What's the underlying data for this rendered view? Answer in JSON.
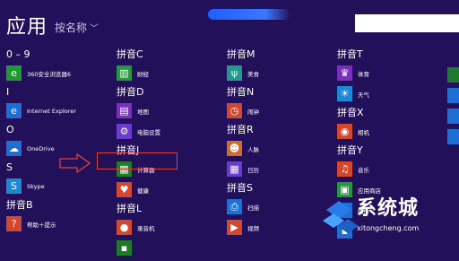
{
  "header": {
    "title": "应用",
    "sort_label": "按名称",
    "search_placeholder": ""
  },
  "columns": [
    {
      "sections": [
        {
          "header": "0 – 9",
          "items": [
            {
              "label": "360安全浏览器6",
              "icon": "360-browser-icon",
              "color": "#1f9a2c"
            }
          ]
        },
        {
          "header": "I",
          "items": [
            {
              "label": "Internet Explorer",
              "icon": "internet-explorer-icon",
              "color": "#1d6fd6"
            }
          ]
        },
        {
          "header": "O",
          "items": [
            {
              "label": "OneDrive",
              "icon": "onedrive-icon",
              "color": "#1d6fd6"
            }
          ]
        },
        {
          "header": "S",
          "items": [
            {
              "label": "Skype",
              "icon": "skype-icon",
              "color": "#1d89d6"
            }
          ]
        },
        {
          "header": "拼音B",
          "items": [
            {
              "label": "帮助＋提示",
              "icon": "help-tips-icon",
              "color": "#d2472d"
            }
          ]
        }
      ]
    },
    {
      "sections": [
        {
          "header": "拼音C",
          "items": [
            {
              "label": "财经",
              "icon": "finance-icon",
              "color": "#1f9a3c"
            }
          ]
        },
        {
          "header": "拼音D",
          "items": [
            {
              "label": "地图",
              "icon": "maps-icon",
              "color": "#7a2fc0"
            },
            {
              "label": "电脑设置",
              "icon": "pc-settings-icon",
              "color": "#6a3bd0"
            }
          ]
        },
        {
          "header": "拼音J",
          "items": [
            {
              "label": "计算器",
              "icon": "calculator-icon",
              "color": "#1f7a2c"
            },
            {
              "label": "健康",
              "icon": "health-icon",
              "color": "#d2472d"
            }
          ]
        },
        {
          "header": "拼音L",
          "items": [
            {
              "label": "录音机",
              "icon": "sound-recorder-icon",
              "color": "#d2472d"
            },
            {
              "label": "",
              "icon": "app-icon",
              "color": "#1f7a2c"
            }
          ]
        }
      ]
    },
    {
      "sections": [
        {
          "header": "拼音M",
          "items": [
            {
              "label": "美食",
              "icon": "food-icon",
              "color": "#1f9a8c"
            }
          ]
        },
        {
          "header": "拼音N",
          "items": [
            {
              "label": "闹钟",
              "icon": "alarms-icon",
              "color": "#d2472d"
            }
          ]
        },
        {
          "header": "拼音R",
          "items": [
            {
              "label": "人脉",
              "icon": "people-icon",
              "color": "#d26a2d"
            },
            {
              "label": "日历",
              "icon": "calendar-icon",
              "color": "#6a3bd0"
            }
          ]
        },
        {
          "header": "拼音S",
          "items": [
            {
              "label": "扫描",
              "icon": "scan-icon",
              "color": "#1d6fd6"
            },
            {
              "label": "视频",
              "icon": "video-icon",
              "color": "#d2472d"
            }
          ]
        }
      ]
    },
    {
      "sections": [
        {
          "header": "拼音T",
          "items": [
            {
              "label": "体育",
              "icon": "sports-icon",
              "color": "#7a2fc0"
            },
            {
              "label": "天气",
              "icon": "weather-icon",
              "color": "#1d89d6"
            }
          ]
        },
        {
          "header": "拼音X",
          "items": [
            {
              "label": "相机",
              "icon": "camera-icon",
              "color": "#d2472d"
            }
          ]
        },
        {
          "header": "拼音Y",
          "items": [
            {
              "label": "音乐",
              "icon": "music-icon",
              "color": "#d2472d"
            },
            {
              "label": "应用商店",
              "icon": "store-icon",
              "color": "#1f9a3c"
            },
            {
              "label": "邮件",
              "icon": "mail-icon",
              "color": "#1d6fd6"
            },
            {
              "label": "",
              "icon": "app-icon",
              "color": "#1d6fd6"
            }
          ]
        }
      ]
    },
    {
      "sections": [
        {
          "header": "",
          "items": [
            {
              "label": "",
              "icon": "app-icon",
              "color": "#1f7a2c"
            },
            {
              "label": "",
              "icon": "app-icon",
              "color": "#1d6fd6"
            },
            {
              "label": "",
              "icon": "app-icon",
              "color": "#1d6fd6"
            },
            {
              "label": "",
              "icon": "app-icon",
              "color": "#1d6fd6"
            }
          ]
        }
      ]
    }
  ],
  "watermark": {
    "text": "系统城",
    "url": "xitongcheng.com"
  },
  "colors": {
    "background": "#23105a",
    "highlight": "#d9433a",
    "accent_blue": "#1d6fd6"
  }
}
